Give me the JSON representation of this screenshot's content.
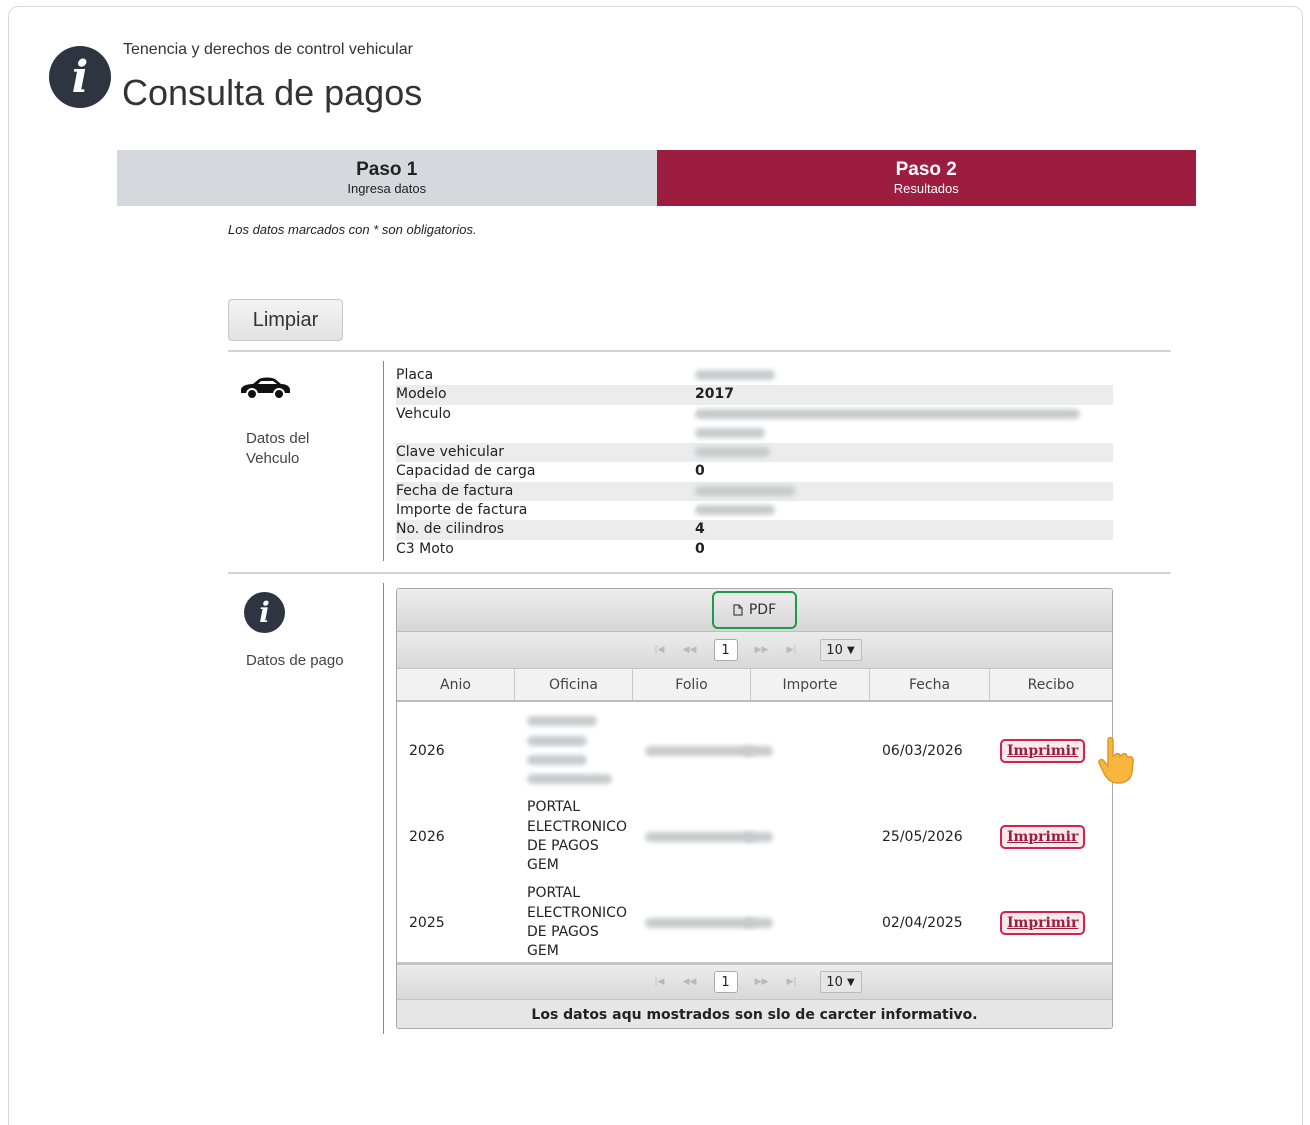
{
  "header": {
    "subtitle": "Tenencia y derechos de control vehicular",
    "title": "Consulta de pagos"
  },
  "steps": [
    {
      "title": "Paso 1",
      "subtitle": "Ingresa datos",
      "active": false
    },
    {
      "title": "Paso 2",
      "subtitle": "Resultados",
      "active": true
    }
  ],
  "note": "Los datos marcados con * son obligatorios.",
  "buttons": {
    "clear_label": "Limpiar"
  },
  "vehicle_section": {
    "label": "Datos del Vehculo",
    "rows": [
      {
        "key": "Placa",
        "value": ""
      },
      {
        "key": "Modelo",
        "value": "2017"
      },
      {
        "key": "Vehculo",
        "value": ""
      },
      {
        "key": "Clave vehicular",
        "value": ""
      },
      {
        "key": "Capacidad de carga",
        "value": "0"
      },
      {
        "key": "Fecha de factura",
        "value": ""
      },
      {
        "key": "Importe de factura",
        "value": ""
      },
      {
        "key": "No. de cilindros",
        "value": "4"
      },
      {
        "key": "C3 Moto",
        "value": "0"
      }
    ]
  },
  "payment_section": {
    "label": "Datos de pago",
    "pdf_label": "PDF",
    "pager": {
      "current_page": "1",
      "page_size": "10"
    },
    "columns": [
      "Anio",
      "Oficina",
      "Folio",
      "Importe",
      "Fecha",
      "Recibo"
    ],
    "rows": [
      {
        "anio": "2026",
        "oficina": "",
        "folio": "",
        "importe": "",
        "fecha": "06/03/2026",
        "recibo": "Imprimir"
      },
      {
        "anio": "2026",
        "oficina": "PORTAL ELECTRONICO DE PAGOS GEM",
        "folio": "",
        "importe": "",
        "fecha": "25/05/2026",
        "recibo": "Imprimir"
      },
      {
        "anio": "2025",
        "oficina": "PORTAL ELECTRONICO DE PAGOS GEM",
        "folio": "",
        "importe": "",
        "fecha": "02/04/2025",
        "recibo": "Imprimir"
      }
    ],
    "footnote": "Los datos aqu mostrados son slo de carcter informativo."
  },
  "colors": {
    "accent": "#9c1d3f",
    "step_inactive": "#d5d9dd",
    "pdf_border": "#1d9a4a",
    "print_border": "#d0244a"
  },
  "icons": {
    "header": "info-icon",
    "vehicle": "car-icon",
    "payment": "info-icon",
    "pdf": "document-icon",
    "cursor": "hand-pointer-icon"
  }
}
